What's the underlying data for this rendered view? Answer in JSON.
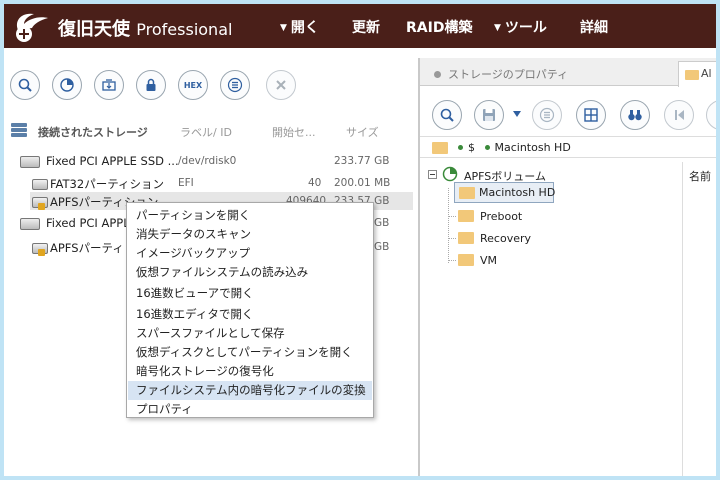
{
  "app": {
    "title_jp": "復旧天使",
    "title_en": "Professional"
  },
  "menu": [
    {
      "label": "開く",
      "has_arrow": true
    },
    {
      "label": "更新",
      "has_arrow": false
    },
    {
      "label": "RAID構築",
      "has_arrow": false
    },
    {
      "label": "ツール",
      "has_arrow": true
    },
    {
      "label": "詳細",
      "has_arrow": false
    }
  ],
  "toolbar_left": {
    "hex_label": "HEX",
    "icons": [
      "search-icon",
      "scan-chart-icon",
      "image-backup-icon",
      "lock-icon",
      "hex-viewer-icon",
      "list-icon",
      "close-icon"
    ]
  },
  "storage_list": {
    "header": "接続されたストレージ",
    "columns": [
      "ラベル/ ID",
      "開始セ...",
      "サイズ"
    ],
    "rows": [
      {
        "name": "Fixed PCI APPLE SSD ...",
        "label_id": "/dev/rdisk0",
        "start": "",
        "size": "233.77 GB"
      },
      {
        "name": "FAT32パーティション",
        "label_id": "EFI",
        "start": "40",
        "size": "200.01 MB"
      },
      {
        "name": "APFSパーティション",
        "label_id": "",
        "start": "409640",
        "size": "233.57 GB"
      },
      {
        "name": "Fixed PCI APPL",
        "label_id": "",
        "start": "",
        "size": "GB"
      },
      {
        "name": "APFSパーティ",
        "label_id": "",
        "start": "",
        "size": "GB"
      }
    ]
  },
  "context_menu": {
    "items": [
      "パーティションを開く",
      "消失データのスキャン",
      "イメージバックアップ",
      "仮想ファイルシステムの読み込み",
      "16進数ビューアで開く",
      "16進数エディタで開く",
      "スパースファイルとして保存",
      "仮想ディスクとしてパーティションを開く",
      "暗号化ストレージの復号化",
      "ファイルシステム内の暗号化ファイルの変換",
      "プロパティ"
    ],
    "highlighted_index": 9
  },
  "right_pane": {
    "tabs": [
      {
        "label": "ストレージのプロパティ"
      },
      {
        "label": "Al"
      }
    ],
    "path": {
      "dollar": "$",
      "volume": "Macintosh HD"
    },
    "tree_root": "APFSボリューム",
    "tree_items": [
      "Macintosh HD",
      "Preboot",
      "Recovery",
      "VM"
    ],
    "column_header": "名前"
  },
  "colors": {
    "titlebar": "#4a1f19",
    "frame_border": "#bfe3f5",
    "highlight": "#d7e4f3",
    "folder": "#f2c879"
  }
}
